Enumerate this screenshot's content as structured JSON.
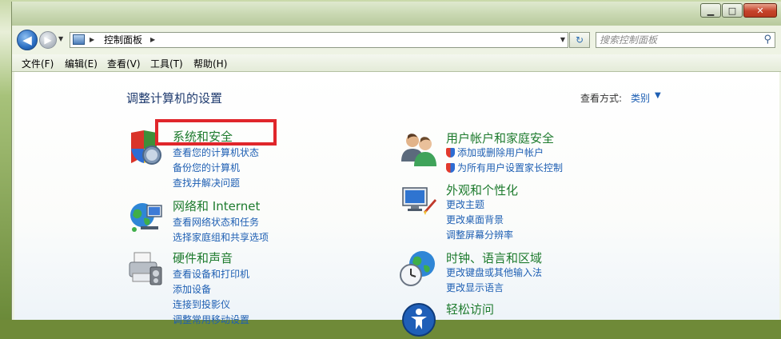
{
  "address": {
    "path_item": "控制面板",
    "search_placeholder": "搜索控制面板"
  },
  "menu": [
    "文件(F)",
    "编辑(E)",
    "查看(V)",
    "工具(T)",
    "帮助(H)"
  ],
  "page": {
    "title": "调整计算机的设置",
    "view_label": "查看方式:",
    "view_value": "类别"
  },
  "categories": [
    {
      "title": "系统和安全",
      "icon": "shield-icon",
      "links": [
        "查看您的计算机状态",
        "备份您的计算机",
        "查找并解决问题"
      ]
    },
    {
      "title": "网络和 Internet",
      "icon": "globe-network-icon",
      "links": [
        "查看网络状态和任务",
        "选择家庭组和共享选项"
      ]
    },
    {
      "title": "硬件和声音",
      "icon": "printer-icon",
      "links": [
        "查看设备和打印机",
        "添加设备",
        "连接到投影仪",
        "调整常用移动设置"
      ]
    },
    {
      "title": "用户帐户和家庭安全",
      "icon": "users-icon",
      "links": [
        "添加或删除用户帐户",
        "为所有用户设置家长控制"
      ]
    },
    {
      "title": "外观和个性化",
      "icon": "monitor-paint-icon",
      "links": [
        "更改主题",
        "更改桌面背景",
        "调整屏幕分辨率"
      ]
    },
    {
      "title": "时钟、语言和区域",
      "icon": "clock-globe-icon",
      "links": [
        "更改键盘或其他输入法",
        "更改显示语言"
      ]
    },
    {
      "title": "轻松访问",
      "icon": "accessibility-icon",
      "links": []
    }
  ],
  "colors": {
    "category_title": "#1e7b2e",
    "link": "#1e5fb3",
    "highlight": "#e0262b"
  }
}
